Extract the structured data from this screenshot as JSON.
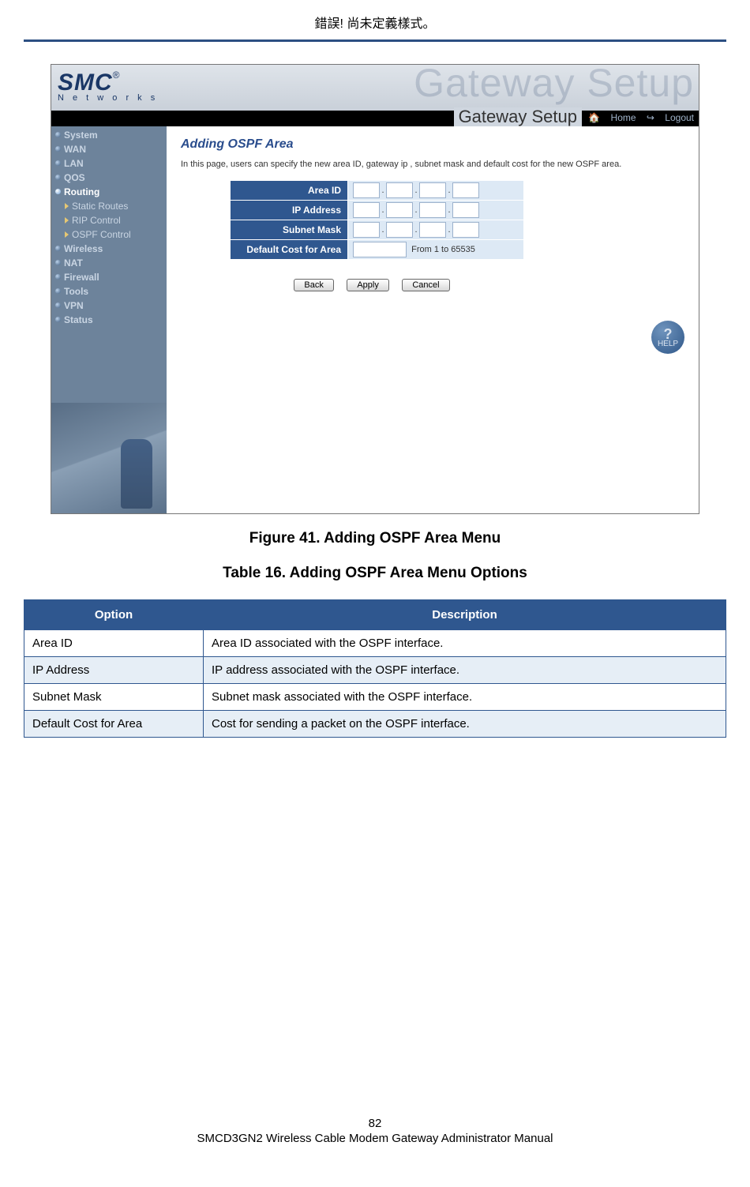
{
  "header_error": "錯誤! 尚未定義樣式。",
  "logo": {
    "main": "SMC",
    "reg": "®",
    "sub": "N e t w o r k s"
  },
  "ghost": "Gateway Setup",
  "blackbar": {
    "setup": "Gateway Setup",
    "home": "Home",
    "logout": "Logout"
  },
  "nav": [
    {
      "label": "System"
    },
    {
      "label": "WAN"
    },
    {
      "label": "LAN"
    },
    {
      "label": "QOS"
    },
    {
      "label": "Routing",
      "active": true
    },
    {
      "label": "Static Routes",
      "child": true
    },
    {
      "label": "RIP Control",
      "child": true
    },
    {
      "label": "OSPF Control",
      "child": true
    },
    {
      "label": "Wireless"
    },
    {
      "label": "NAT"
    },
    {
      "label": "Firewall"
    },
    {
      "label": "Tools"
    },
    {
      "label": "VPN"
    },
    {
      "label": "Status"
    }
  ],
  "panel": {
    "title": "Adding OSPF Area",
    "intro": "In this page, users can specify the new area ID, gateway ip , subnet mask and default cost for the new OSPF area.",
    "rows": {
      "area_id": "Area ID",
      "ip": "IP Address",
      "mask": "Subnet Mask",
      "cost": "Default Cost for Area"
    },
    "cost_hint": "From 1 to 65535",
    "buttons": {
      "back": "Back",
      "apply": "Apply",
      "cancel": "Cancel"
    },
    "help": "HELP"
  },
  "figure_caption": "Figure 41. Adding OSPF Area Menu",
  "table_caption": "Table 16. Adding OSPF Area Menu Options",
  "table": {
    "head_option": "Option",
    "head_desc": "Description",
    "rows": [
      {
        "opt": "Area ID",
        "desc": "Area ID associated with the OSPF interface."
      },
      {
        "opt": "IP Address",
        "desc": "IP address associated with the OSPF interface."
      },
      {
        "opt": "Subnet Mask",
        "desc": "Subnet mask associated with the OSPF interface."
      },
      {
        "opt": "Default Cost for Area",
        "desc": "Cost for sending a packet on the OSPF interface."
      }
    ]
  },
  "page_number": "82",
  "footer": "SMCD3GN2 Wireless Cable Modem Gateway Administrator Manual"
}
